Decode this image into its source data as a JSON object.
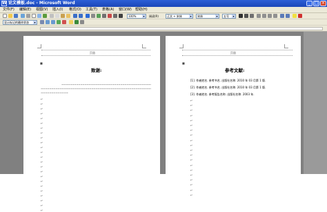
{
  "window": {
    "title": "论文模板.doc - Microsoft Word",
    "icon": "word-icon"
  },
  "menu": {
    "items": [
      "文件(F)",
      "编辑(E)",
      "视图(V)",
      "插入(I)",
      "格式(O)",
      "工具(T)",
      "表格(A)",
      "窗口(W)",
      "帮助(H)"
    ]
  },
  "toolbar": {
    "zoom": "100%",
    "reading_label": "阅读(R)",
    "style": "正文 + 宋体",
    "font": "宋体",
    "size": "五号"
  },
  "formatting_toolbar": {
    "style_box": "显示标记的最终状态"
  },
  "left_page": {
    "header_label": "页眉",
    "heading": "致谢:",
    "ack_dash_lines": 3,
    "para_marks": 24
  },
  "right_page": {
    "header_label": "页眉",
    "heading": "参考文献:",
    "references": [
      "[1]. 作者姓名. 参考书名. 出版社名称. 2010 年 03 月第 1 版.",
      "[2]. 作者姓名. 参考书名. 出版社名称. 2010 年 03 月第 1 版.",
      "[3]. 作者姓名. 参考报告名称. 出版社名称. 2003 年."
    ],
    "para_marks": 20
  },
  "colors": {
    "titlebar": "#1b46b8",
    "chrome": "#ece9d8",
    "workspace": "#808080"
  }
}
